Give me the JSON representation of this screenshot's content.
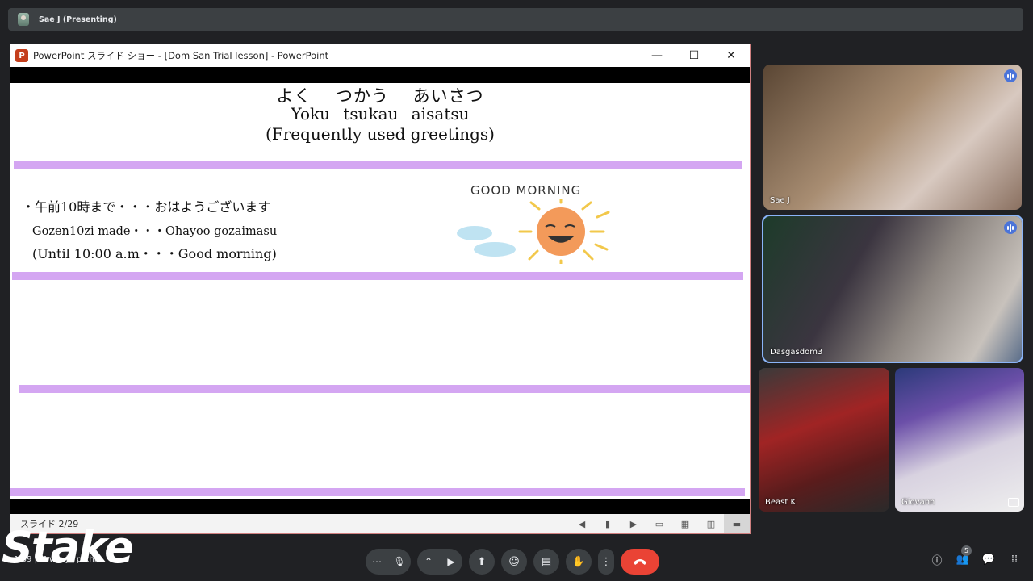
{
  "presenter": {
    "label": "Sae J (Presenting)"
  },
  "ppt_window": {
    "title": "PowerPoint スライド ショー - [Dom San Trial lesson] - PowerPoint",
    "icon_letter": "P",
    "minimize": "—",
    "maximize": "☐",
    "close": "✕"
  },
  "slide": {
    "title_jp": "よく　 つかう　 あいさつ",
    "title_romaji": "Yoku tsukau  aisatsu",
    "title_en": "(Frequently used greetings)",
    "greeting_jp": "・午前10時まで・・・おはようございます",
    "greeting_romaji": "Gozen10zi made・・・Ohayoo gozaimasu",
    "greeting_en": "(Until 10:00 a.m・・・Good morning)",
    "illustration_text": "GOOD MORNING"
  },
  "ppt_status": {
    "slide_counter": "スライド 2/29"
  },
  "participants": [
    {
      "name": "Sae J"
    },
    {
      "name": "Dasgasdom3"
    },
    {
      "name": "Beast K"
    },
    {
      "name": "Giovann"
    }
  ],
  "bottom_bar": {
    "meeting_info": "1:39  |  M    w  a  j  r  p  xhf",
    "participant_count": "5"
  },
  "stake_watermark": "Stake"
}
